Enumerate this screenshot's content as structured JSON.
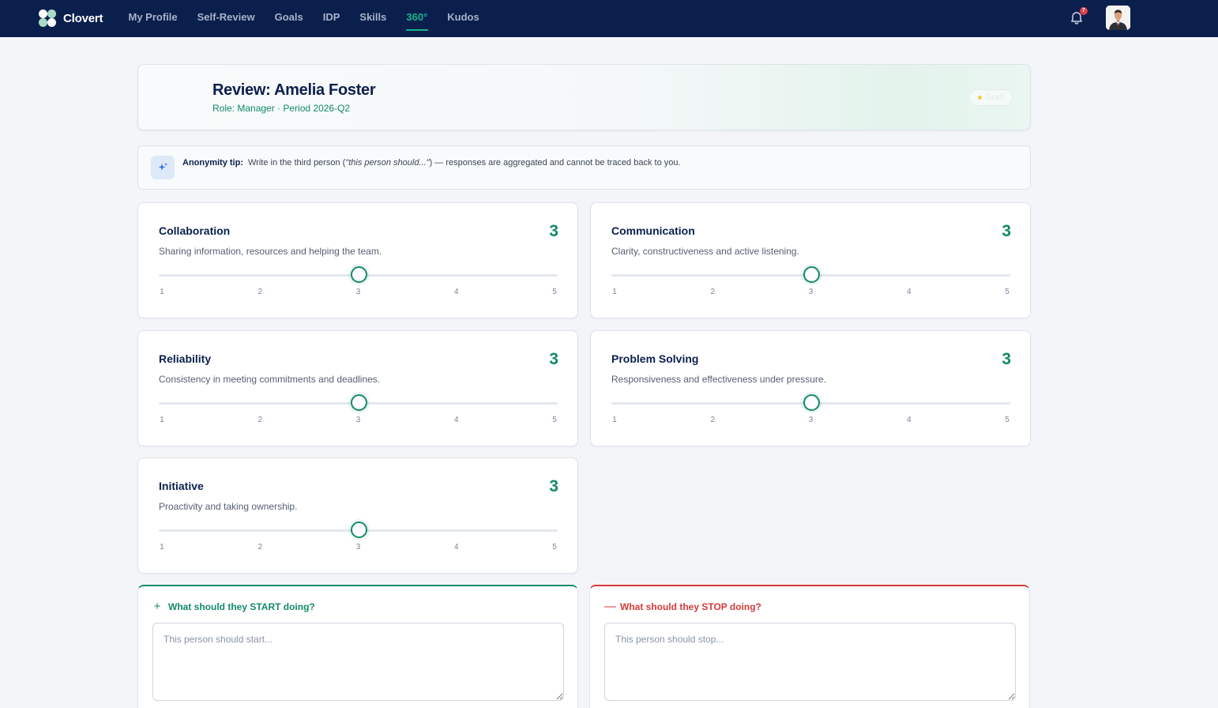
{
  "app": {
    "name": "Clovert",
    "nav": [
      {
        "label": "My Profile",
        "active": false
      },
      {
        "label": "Self-Review",
        "active": false
      },
      {
        "label": "Goals",
        "active": false
      },
      {
        "label": "IDP",
        "active": false
      },
      {
        "label": "Skills",
        "active": false
      },
      {
        "label": "360°",
        "active": true
      },
      {
        "label": "Kudos",
        "active": false
      }
    ],
    "notification_count": "7",
    "icons": {
      "logo": "clover-logo-icon",
      "notifications": "bell-icon",
      "avatar": "user-avatar"
    }
  },
  "review": {
    "title": "Review: Amelia Foster",
    "subtitle": "Role: Manager · Period 2026-Q2",
    "status": "Draft"
  },
  "tip": {
    "label": "Anonymity tip:",
    "text_before": "Write in the third person (",
    "text_em": "\"this person should...\"",
    "text_after": ") — responses are aggregated and cannot be traced back to you.",
    "icon": "sparkles-icon"
  },
  "ratings": [
    {
      "name": "Collaboration",
      "description": "Sharing information, resources and helping the team.",
      "score": "3"
    },
    {
      "name": "Communication",
      "description": "Clarity, constructiveness and active listening.",
      "score": "3"
    },
    {
      "name": "Reliability",
      "description": "Consistency in meeting commitments and deadlines.",
      "score": "3"
    },
    {
      "name": "Problem Solving",
      "description": "Responsiveness and effectiveness under pressure.",
      "score": "3"
    },
    {
      "name": "Initiative",
      "description": "Proactivity and taking ownership.",
      "score": "3"
    }
  ],
  "scale": {
    "min": 1,
    "max": 5,
    "ticks": [
      "1",
      "2",
      "3",
      "4",
      "5"
    ]
  },
  "feedback": {
    "start": {
      "title": "What should they START doing?",
      "placeholder": "This person should start...",
      "value": "",
      "symbol": "+"
    },
    "stop": {
      "title": "What should they STOP doing?",
      "placeholder": "This person should stop...",
      "value": "",
      "symbol": "—"
    }
  },
  "colors": {
    "nav_bg": "#0b1f4d",
    "accent": "#138a6b",
    "accent_active": "#17b38a",
    "danger": "#d63a3a",
    "badge": "#e33d4c",
    "tip_icon_bg": "#dde9f8"
  }
}
